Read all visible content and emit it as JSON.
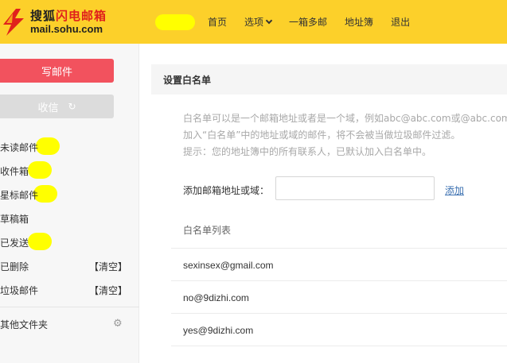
{
  "header": {
    "logo_cn_red": "闪电邮箱",
    "logo_cn_dark": "搜狐",
    "logo_url": "mail.sohu.com",
    "nav": [
      "首页",
      "选项",
      "一箱多邮",
      "地址簿",
      "退出"
    ]
  },
  "sidebar": {
    "compose_label": "写邮件",
    "receive_label": "收信",
    "refresh_icon": "↻",
    "folders": [
      {
        "name": "未读邮件"
      },
      {
        "name": "收件箱"
      },
      {
        "name": "星标邮件"
      },
      {
        "name": "草稿箱"
      },
      {
        "name": "已发送"
      },
      {
        "name": "已删除",
        "action": "【清空】"
      },
      {
        "name": "垃圾邮件",
        "action": "【清空】"
      }
    ],
    "other_folders": "其他文件夹",
    "gear_icon": "⚙"
  },
  "main": {
    "title": "设置白名单",
    "desc_line1": "白名单可以是一个邮箱地址或者是一个域，例如abc@abc.com或@abc.com",
    "desc_line2": "加入“白名单”中的地址或域的邮件，将不会被当做垃圾邮件过滤。",
    "desc_line3": "提示：您的地址簿中的所有联系人，已默认加入白名单中。",
    "add_label": "添加邮箱地址或域：",
    "add_input_value": "",
    "add_link": "添加",
    "list_title": "白名单列表",
    "entries": [
      "sexinsex@gmail.com",
      "no@9dizhi.com",
      "yes@9dizhi.com"
    ]
  }
}
